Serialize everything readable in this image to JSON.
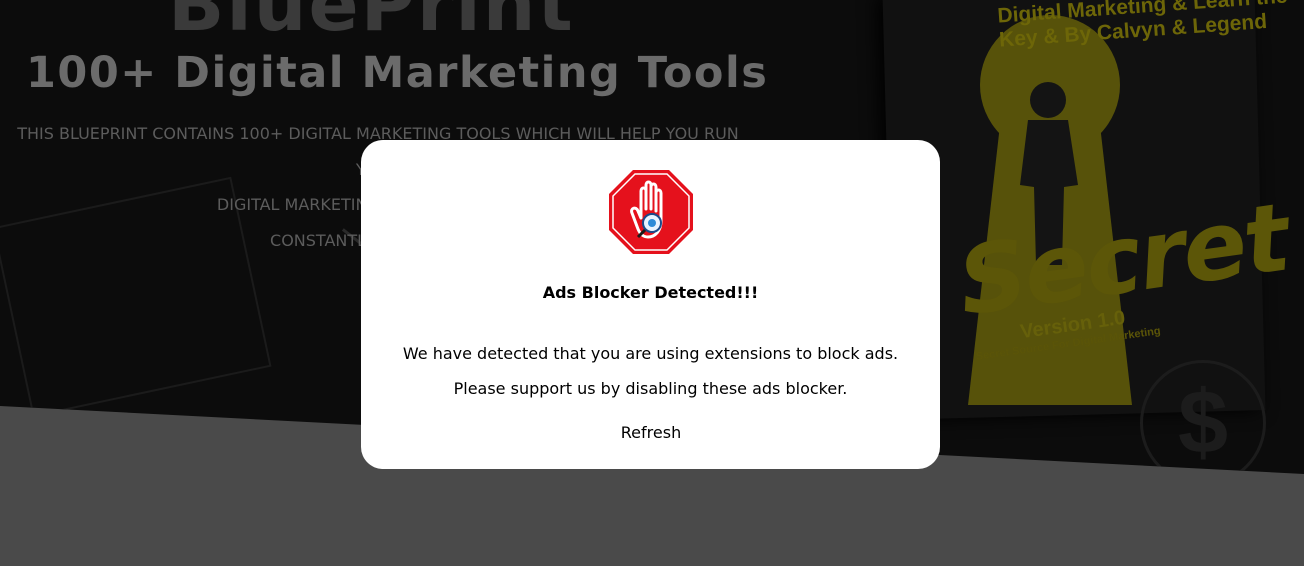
{
  "hero": {
    "title_top": "BluePrint",
    "title": "100+ Digital Marketing Tools",
    "description_lines": [
      "THIS BLUEPRINT CONTAINS 100+ DIGITAL MARKETING TOOLS WHICH WILL HELP YOU RUN YOUR",
      "DIGITAL MARKETING CAMPAIGN SUCCES",
      "CONSTANTLY UPDATE, CUR"
    ]
  },
  "book": {
    "arc_text": "Digital Marketing & Learn the Key & By Calvyn & Legend",
    "title": "Secret",
    "version": "Version 1.0",
    "subtitle": "Secret Source For Digital Marketing"
  },
  "modal": {
    "icon": "stop-hand-icon",
    "title": "Ads Blocker Detected!!!",
    "message_lines": [
      "We have detected that you are using extensions to block ads.",
      "Please support us by disabling these ads blocker."
    ],
    "refresh_label": "Refresh"
  },
  "colors": {
    "overlay_dark": "#0c0c0c",
    "page_gray": "#4a4a4a",
    "stop_red": "#e5111c",
    "book_gold": "#5c5608"
  }
}
